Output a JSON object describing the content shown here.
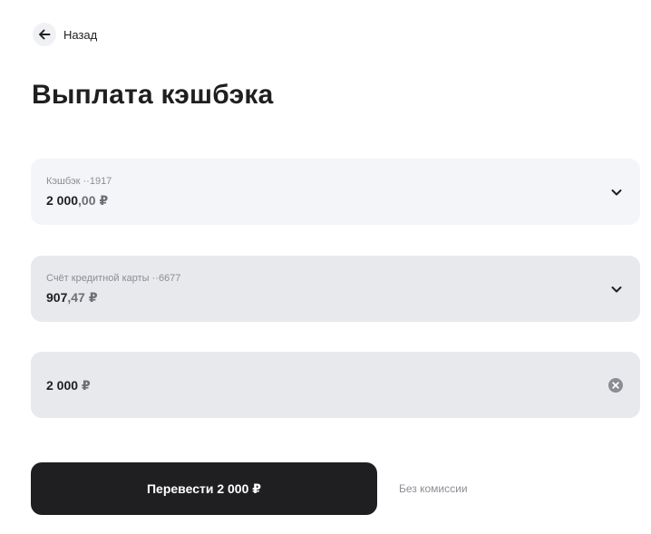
{
  "header": {
    "back_label": "Назад",
    "title": "Выплата кэшбэка"
  },
  "icons": {
    "back": "arrow-left-icon",
    "dropdown": "chevron-down-icon",
    "clear": "clear-circle-icon"
  },
  "source_account": {
    "label": "Кэшбэк ··1917",
    "amount_integer": "2 000",
    "amount_fraction": ",00",
    "currency": "₽"
  },
  "target_account": {
    "label": "Счёт кредитной карты ··6677",
    "amount_integer": "907",
    "amount_fraction": ",47",
    "currency": "₽"
  },
  "transfer_amount": {
    "value": "2 000",
    "currency": "₽"
  },
  "actions": {
    "transfer_label": "Перевести 2 000 ₽",
    "commission_note": "Без комиссии"
  },
  "colors": {
    "button_background": "#1f1f22",
    "field_background": "#e8e9ec",
    "field_background_light": "#f4f5f8",
    "secondary_text": "#8b8d94"
  }
}
